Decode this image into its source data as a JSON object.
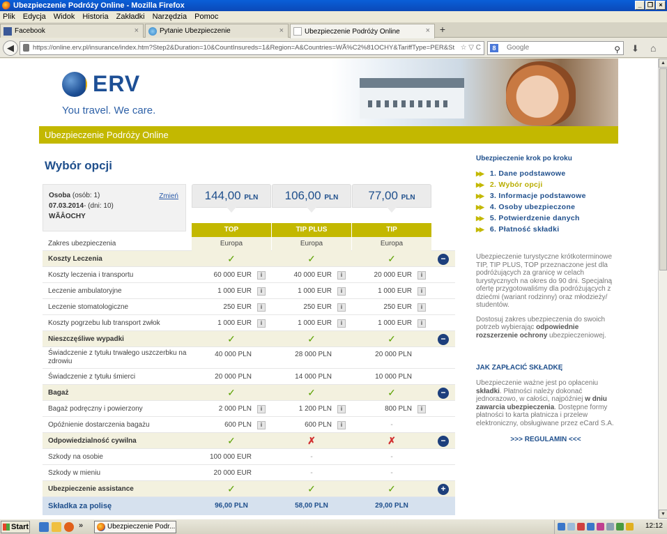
{
  "window": {
    "title": "Ubezpieczenie Podróży Online - Mozilla Firefox",
    "buttons": [
      "_",
      "❐",
      "×"
    ]
  },
  "menu": [
    "Plik",
    "Edycja",
    "Widok",
    "Historia",
    "Zakładki",
    "Narzędzia",
    "Pomoc"
  ],
  "tabs": [
    {
      "label": "Facebook",
      "close": "×"
    },
    {
      "label": "Pytanie Ubezpieczenie",
      "close": "×"
    },
    {
      "label": "Ubezpieczenie Podróży Online",
      "close": "×"
    }
  ],
  "newtab": "+",
  "nav": {
    "url": "https://online.erv.pl/insurance/index.htm?Step2&Duration=10&CountInsureds=1&Region=A&Countries=WÃ%C2%81OCHY&TariffType=PER&St",
    "url_tail": "☆ ▽ C",
    "search_placeholder": "Google",
    "search_engine": "8"
  },
  "header": {
    "logo": "ERV",
    "claim": "You travel. We care.",
    "bar_title": "Ubezpieczenie Podróży Online"
  },
  "page": {
    "title": "Wybór opcji"
  },
  "person": {
    "line1_bold": "Osoba",
    "line1_rest": " (osób: 1)",
    "line2_bold": "07.03.2014",
    "line2_rest": "- (dni: 10)",
    "line3": "WÃÂOCHY",
    "change": "Zmień"
  },
  "plans": [
    {
      "price": "144,00",
      "currency": "PLN",
      "name": "TOP"
    },
    {
      "price": "106,00",
      "currency": "PLN",
      "name": "TIP PLUS"
    },
    {
      "price": "77,00",
      "currency": "PLN",
      "name": "TIP"
    }
  ],
  "rows": [
    {
      "type": "zakres",
      "label": "Zakres ubezpieczenia",
      "cells": [
        "Europa",
        "Europa",
        "Europa"
      ]
    },
    {
      "type": "section",
      "label": "Koszty Leczenia",
      "cells": [
        "✓",
        "✓",
        "✓"
      ],
      "toggle": "−"
    },
    {
      "type": "item",
      "label": "Koszty leczenia i transportu",
      "cells": [
        "60 000 EUR",
        "40 000 EUR",
        "20 000 EUR"
      ],
      "info": true
    },
    {
      "type": "item",
      "label": "Leczenie ambulatoryjne",
      "cells": [
        "1 000 EUR",
        "1 000 EUR",
        "1 000 EUR"
      ],
      "info": true
    },
    {
      "type": "item",
      "label": "Leczenie stomatologiczne",
      "cells": [
        "250 EUR",
        "250 EUR",
        "250 EUR"
      ],
      "info": true
    },
    {
      "type": "item",
      "label": "Koszty pogrzebu lub transport zwłok",
      "cells": [
        "1 000 EUR",
        "1 000 EUR",
        "1 000 EUR"
      ],
      "info": true
    },
    {
      "type": "section",
      "label": "Nieszczęśliwe wypadki",
      "cells": [
        "✓",
        "✓",
        "✓"
      ],
      "toggle": "−"
    },
    {
      "type": "item",
      "label": "Świadczenie z tytułu trwałego uszczerbku na zdrowiu",
      "cells": [
        "40 000 PLN",
        "28 000 PLN",
        "20 000 PLN"
      ],
      "tall": true
    },
    {
      "type": "item",
      "label": "Świadczenie z tytułu śmierci",
      "cells": [
        "20 000 PLN",
        "14 000 PLN",
        "10 000 PLN"
      ]
    },
    {
      "type": "section",
      "label": "Bagaż",
      "cells": [
        "✓",
        "✓",
        "✓"
      ],
      "toggle": "−"
    },
    {
      "type": "item",
      "label": "Bagaż podręczny i powierzony",
      "cells": [
        "2 000 PLN",
        "1 200 PLN",
        "800 PLN"
      ],
      "info": true
    },
    {
      "type": "item",
      "label": "Opóźnienie dostarczenia bagażu",
      "cells": [
        "600 PLN",
        "600 PLN",
        "-"
      ],
      "info": true
    },
    {
      "type": "section",
      "label": "Odpowiedzialność cywilna",
      "cells": [
        "✓",
        "✗",
        "✗"
      ],
      "toggle": "−"
    },
    {
      "type": "item",
      "label": "Szkody na osobie",
      "cells": [
        "100 000 EUR",
        "-",
        "-"
      ]
    },
    {
      "type": "item",
      "label": "Szkody w mieniu",
      "cells": [
        "20 000 EUR",
        "-",
        "-"
      ]
    },
    {
      "type": "section",
      "label": "Ubezpieczenie assistance",
      "cells": [
        "✓",
        "✓",
        "✓"
      ],
      "toggle": "+"
    },
    {
      "type": "skladka",
      "label": "Składka za polisę",
      "cells": [
        "96,00 PLN",
        "58,00 PLN",
        "29,00 PLN"
      ]
    }
  ],
  "sidebar": {
    "title": "Ubezpieczenie krok po kroku",
    "steps": [
      "1. Dane podstawowe",
      "2. Wybór opcji",
      "3. Informacje podstawowe",
      "4. Osoby ubezpieczone",
      "5. Potwierdzenie danych",
      "6. Płatność składki"
    ],
    "current_step": 1,
    "desc": "Ubezpieczenie turystyczne krótkoterminowe TIP, TIP PLUS, TOP przeznaczone jest dla podróżujących za granicę w celach turystycznych na okres do 90 dni. Specjalną ofertę przygotowaliśmy dla podróżujących z dziećmi (wariant rodzinny) oraz młodzieży/ studentów.",
    "desc2_a": "Dostosuj zakres ubezpieczenia do swoich potrzeb wybierając ",
    "desc2_b": "odpowiednie rozszerzenie ochrony",
    "desc2_c": " ubezpieczeniowej.",
    "pay_title": "JAK ZAPŁACIĆ SKŁADKĘ",
    "pay_a": "Ubezpieczenie ważne jest po opłaceniu ",
    "pay_b": "składki",
    "pay_c": ". Płatności należy dokonać jednorazowo, w całości, najpóźniej ",
    "pay_d": "w dniu zawarcia ubezpieczenia",
    "pay_e": ". Dostępne formy płatności to karta płatnicza i przelew elektroniczny, obsługiwane przez eCard S.A.",
    "regulamin": ">>> REGULAMIN <<<"
  },
  "taskbar": {
    "start": "Start",
    "quicklaunch_more": "»",
    "task": "Ubezpieczenie Podr...",
    "clock": "12:12"
  },
  "colors": {
    "accent": "#c3b800",
    "brand_blue": "#1f4f8c",
    "check": "#5aa100",
    "cross": "#d23030"
  }
}
